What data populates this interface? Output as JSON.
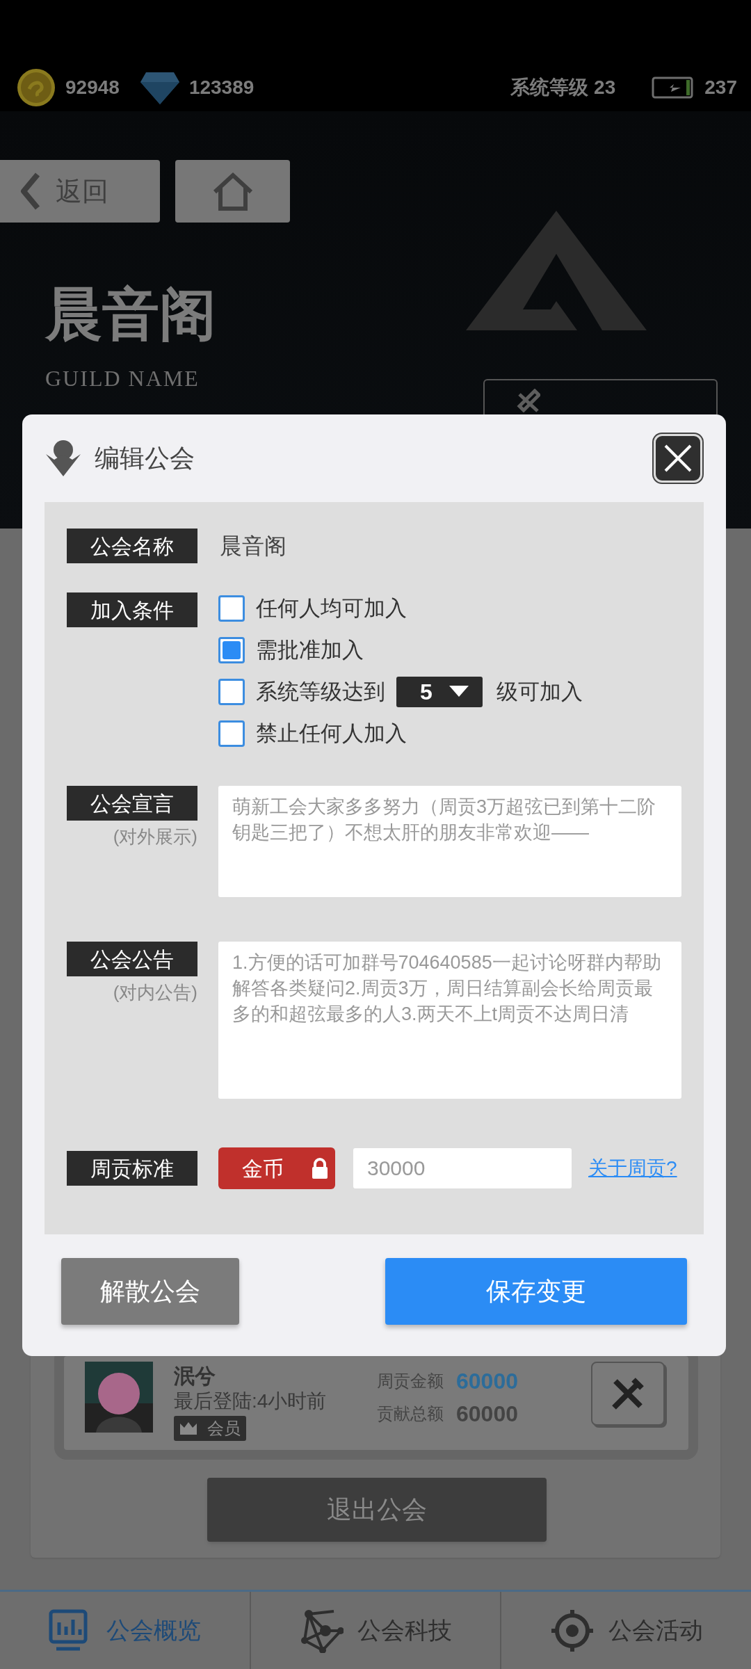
{
  "status_bar": {
    "gold": "92948",
    "gems": "123389",
    "level_label": "系统等级 23",
    "energy": "237"
  },
  "nav": {
    "back": "返回"
  },
  "guild": {
    "name": "晨音阁",
    "subtitle": "GUILD NAME"
  },
  "member": {
    "name": "泯兮",
    "last_login": "最后登陆:4小时前",
    "role": "会员",
    "stats": [
      {
        "label": "周贡金额",
        "value": "60000",
        "highlight": true
      },
      {
        "label": "贡献总额",
        "value": "60000",
        "highlight": false
      }
    ]
  },
  "leave_button": "退出公会",
  "tabs": [
    {
      "label": "公会概览",
      "selected": true
    },
    {
      "label": "公会科技",
      "selected": false
    },
    {
      "label": "公会活动",
      "selected": false
    }
  ],
  "dialog": {
    "title": "编辑公会",
    "name_field": {
      "label": "公会名称",
      "value": "晨音阁"
    },
    "join_conditions": {
      "label": "加入条件",
      "options": [
        {
          "kind": "plain",
          "text": "任何人均可加入",
          "checked": false
        },
        {
          "kind": "plain",
          "text": "需批准加入",
          "checked": true
        },
        {
          "kind": "level",
          "text": "系统等级达到",
          "level": "5",
          "suffix": "级可加入",
          "checked": false
        },
        {
          "kind": "plain",
          "text": "禁止任何人加入",
          "checked": false
        }
      ]
    },
    "declaration": {
      "label": "公会宣言",
      "sublabel": "(对外展示)",
      "text": "萌新工会大家多多努力（周贡3万超弦已到第十二阶钥匙三把了）不想太肝的朋友非常欢迎——"
    },
    "notice": {
      "label": "公会公告",
      "sublabel": "(对内公告)",
      "text": "1.方便的话可加群号704640585一起讨论呀群内帮助解答各类疑问2.周贡3万，周日结算副会长给周贡最多的和超弦最多的人3.两天不上t周贡不达周日清"
    },
    "weekly": {
      "label": "周贡标准",
      "currency": "金币",
      "locked": true,
      "value": "30000",
      "link": "关于周贡?"
    },
    "buttons": [
      {
        "kind": "secondary",
        "label": "解散公会"
      },
      {
        "kind": "primary",
        "label": "保存变更"
      }
    ]
  }
}
